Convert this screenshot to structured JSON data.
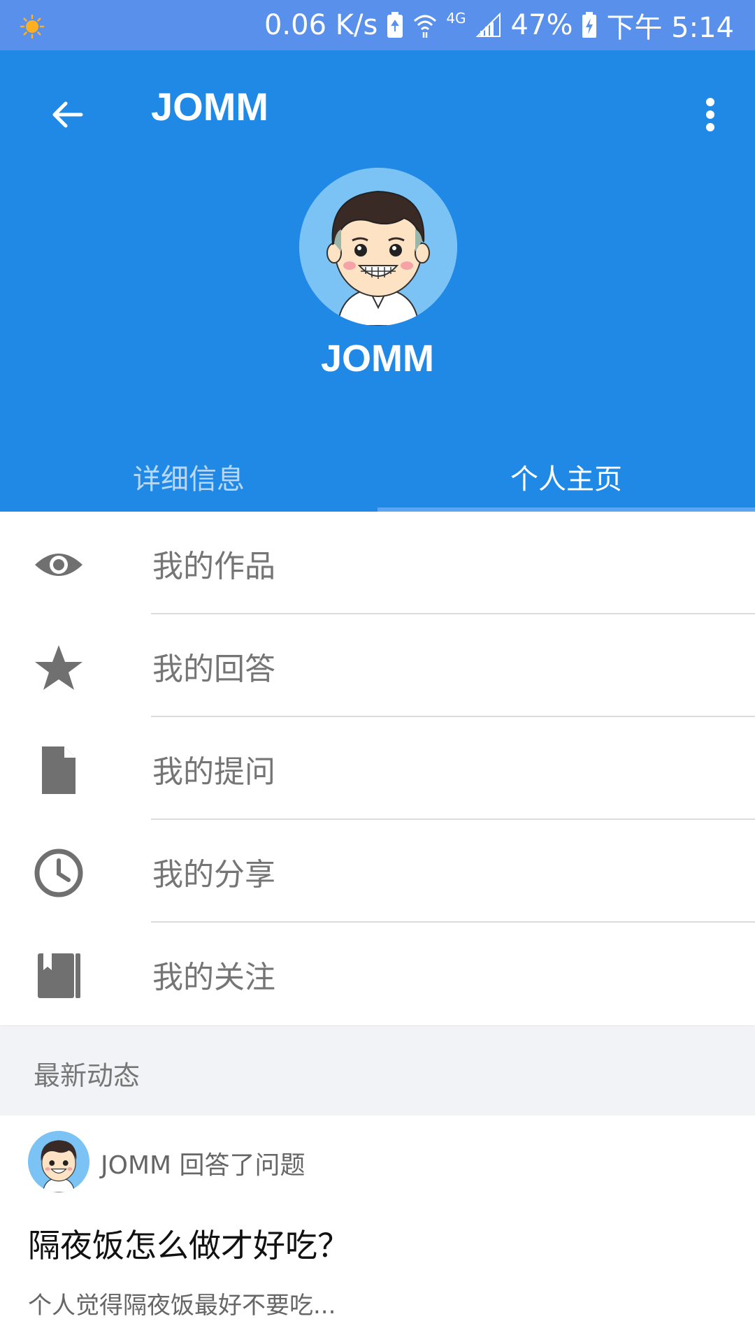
{
  "status_bar": {
    "speed": "0.06 K/s",
    "network": "4G",
    "battery": "47%",
    "time": "下午 5:14"
  },
  "app_bar": {
    "title": "JOMM"
  },
  "profile": {
    "name": "JOMM"
  },
  "tabs": [
    {
      "label": "详细信息",
      "active": false
    },
    {
      "label": "个人主页",
      "active": true
    }
  ],
  "menu": [
    {
      "label": "我的作品",
      "icon": "eye-icon"
    },
    {
      "label": "我的回答",
      "icon": "star-icon"
    },
    {
      "label": "我的提问",
      "icon": "document-icon"
    },
    {
      "label": "我的分享",
      "icon": "clock-icon"
    },
    {
      "label": "我的关注",
      "icon": "book-icon"
    }
  ],
  "section": {
    "title": "最新动态"
  },
  "feed": [
    {
      "meta": "JOMM 回答了问题",
      "title": "隔夜饭怎么做才好吃？",
      "excerpt": "个人觉得隔夜饭最好不要吃..."
    }
  ],
  "colors": {
    "status_bar": "#5990ec",
    "primary": "#2089e6",
    "indicator": "#5aa6f5",
    "section_bg": "#f2f3f7"
  }
}
